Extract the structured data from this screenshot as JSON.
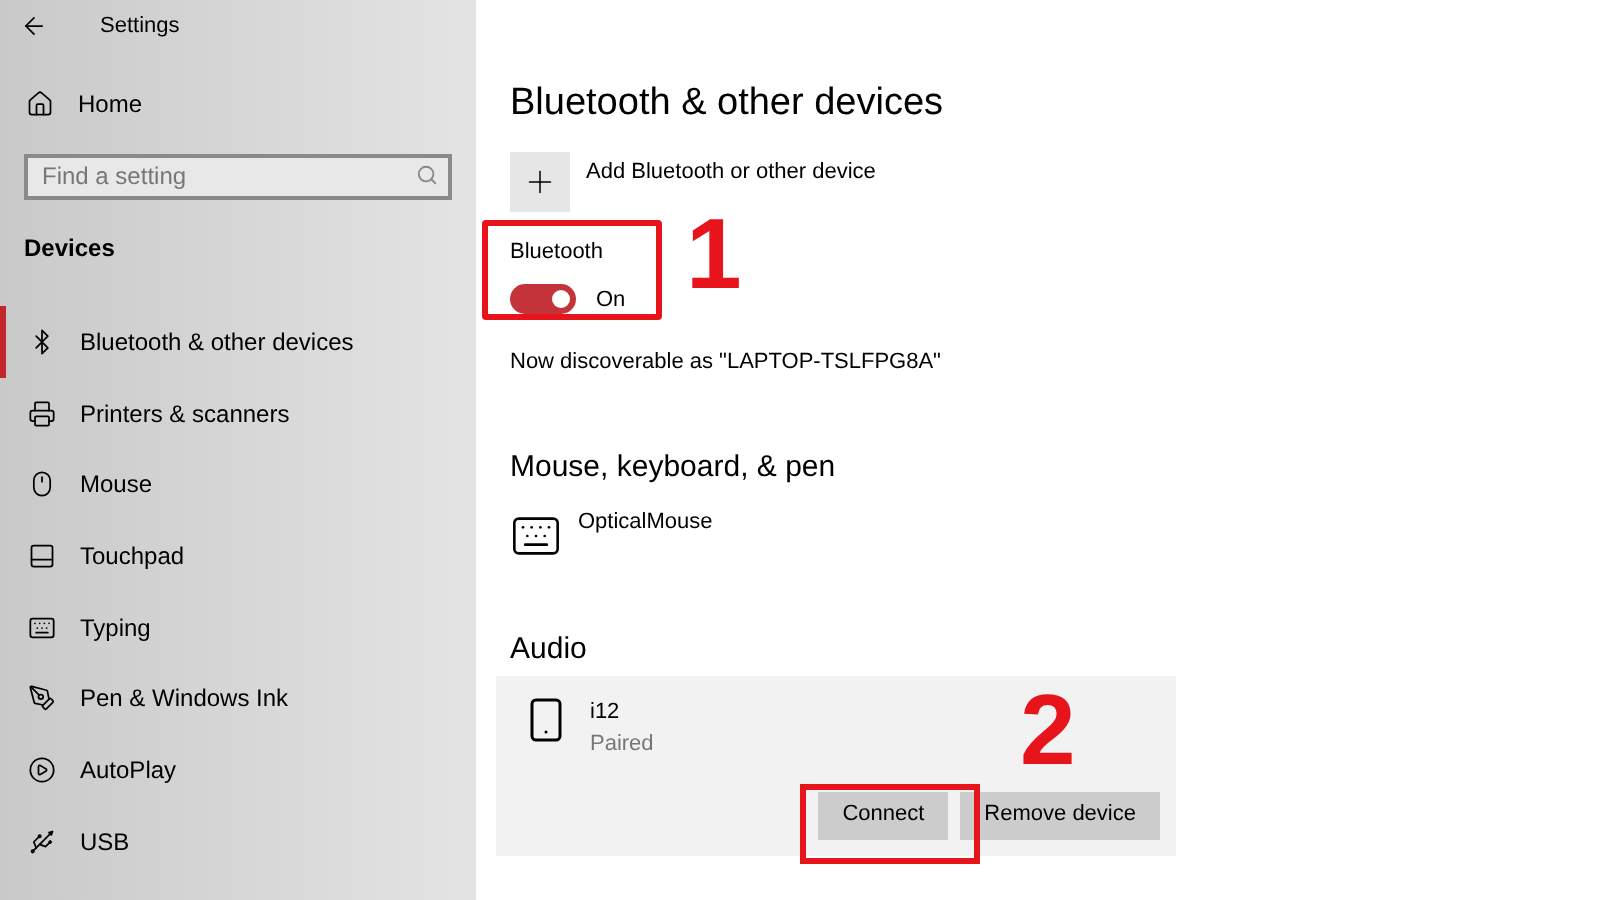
{
  "window": {
    "title": "Settings"
  },
  "sidebar": {
    "home": "Home",
    "search": {
      "placeholder": "Find a setting"
    },
    "section": "Devices",
    "items": [
      {
        "label": "Bluetooth & other devices",
        "selected": true
      },
      {
        "label": "Printers & scanners",
        "selected": false
      },
      {
        "label": "Mouse",
        "selected": false
      },
      {
        "label": "Touchpad",
        "selected": false
      },
      {
        "label": "Typing",
        "selected": false
      },
      {
        "label": "Pen & Windows Ink",
        "selected": false
      },
      {
        "label": "AutoPlay",
        "selected": false
      },
      {
        "label": "USB",
        "selected": false
      }
    ]
  },
  "main": {
    "title": "Bluetooth & other devices",
    "add_button": "Add Bluetooth or other device",
    "bluetooth": {
      "label": "Bluetooth",
      "on": true,
      "state_text": "On",
      "annotation": "1"
    },
    "discoverable": "Now discoverable as \"LAPTOP-TSLFPG8A\"",
    "mouse_section": {
      "heading": "Mouse, keyboard, & pen",
      "devices": [
        {
          "name": "OpticalMouse"
        }
      ]
    },
    "audio_section": {
      "heading": "Audio",
      "devices": [
        {
          "name": "i12",
          "status": "Paired",
          "buttons": [
            "Connect",
            "Remove device"
          ],
          "annotation": "2"
        }
      ]
    }
  }
}
